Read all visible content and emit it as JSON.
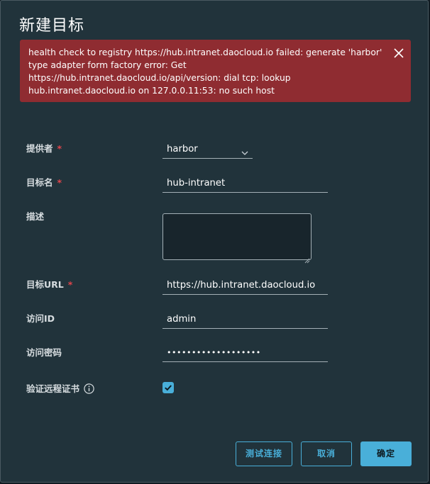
{
  "dialog": {
    "title": "新建目标"
  },
  "alert": {
    "lines": [
      "health check to registry https://hub.intranet.daocloud.io failed: generate 'harbor'",
      "type adapter form factory error: Get",
      "https://hub.intranet.daocloud.io/api/version: dial tcp: lookup",
      "hub.intranet.daocloud.io on 127.0.0.11:53: no such host"
    ],
    "close_icon": "close-icon"
  },
  "form": {
    "required_mark": "*",
    "provider": {
      "label": "提供者",
      "value": "harbor"
    },
    "target_name": {
      "label": "目标名",
      "value": "hub-intranet"
    },
    "description": {
      "label": "描述",
      "value": ""
    },
    "target_url": {
      "label": "目标URL",
      "value": "https://hub.intranet.daocloud.io"
    },
    "access_id": {
      "label": "访问ID",
      "value": "admin"
    },
    "access_secret": {
      "label": "访问密码",
      "value": "•••••••••••••••••••"
    },
    "verify_cert": {
      "label": "验证远程证书",
      "checked": true,
      "info_icon": "info-icon"
    }
  },
  "buttons": {
    "test": "测试连接",
    "cancel": "取消",
    "ok": "确定"
  },
  "colors": {
    "modal_bg": "#21333b",
    "alert_bg": "#8f2c31",
    "accent": "#49afd9",
    "required": "#e0454b"
  }
}
